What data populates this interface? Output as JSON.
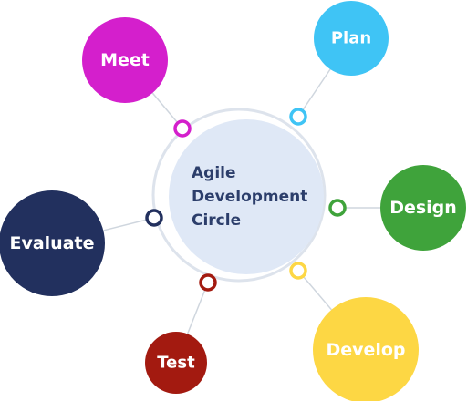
{
  "center": {
    "lines": [
      "Agile",
      "Development",
      "Circle"
    ]
  },
  "nodes": [
    {
      "key": "meet",
      "label": "Meet",
      "color": "#d41fcc"
    },
    {
      "key": "plan",
      "label": "Plan",
      "color": "#3fc4f5"
    },
    {
      "key": "design",
      "label": "Design",
      "color": "#3fa33b"
    },
    {
      "key": "develop",
      "label": "Develop",
      "color": "#fdd744"
    },
    {
      "key": "test",
      "label": "Test",
      "color": "#a31a10"
    },
    {
      "key": "evaluate",
      "label": "Evaluate",
      "color": "#22305e"
    }
  ],
  "colors": {
    "center_fill": "#dfe8f6",
    "ring": "#dde3ec",
    "connector": "#cfd6de",
    "center_text": "#2c3e6b"
  }
}
